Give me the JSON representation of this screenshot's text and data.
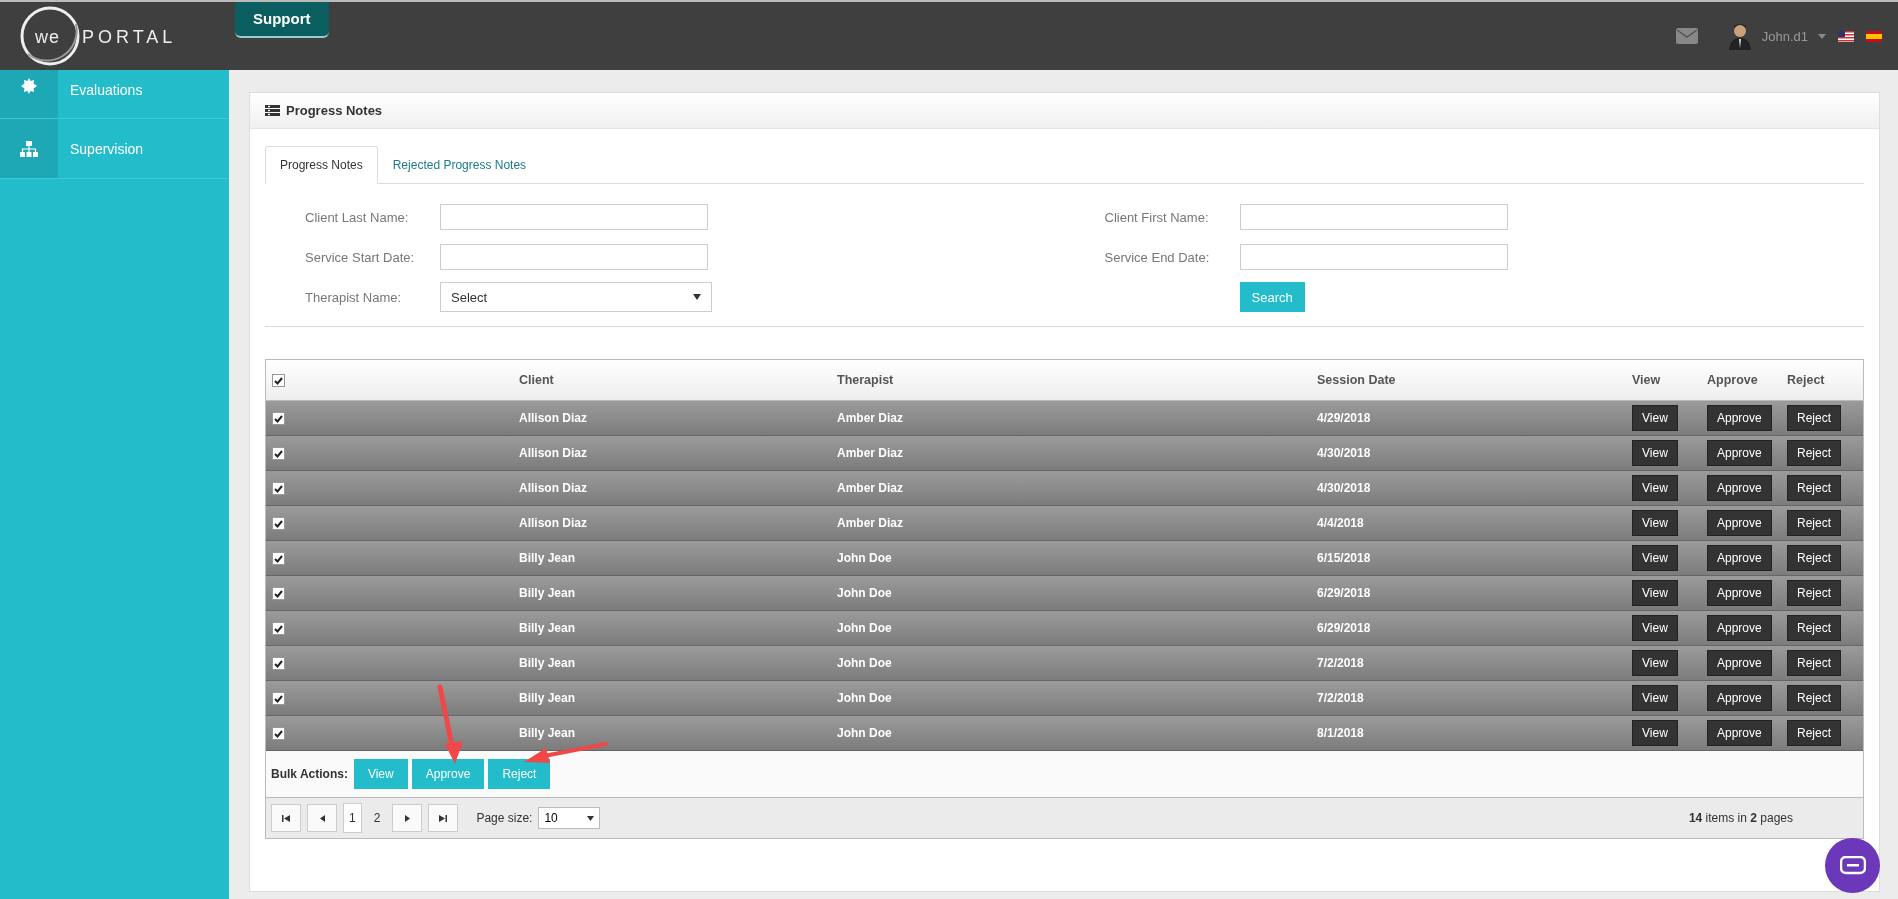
{
  "header": {
    "logo_prefix": "we",
    "logo_name": "PORTAL",
    "support_button": "Support",
    "user_name": "John.d1"
  },
  "sidebar": {
    "items": [
      {
        "label": "Evaluations"
      },
      {
        "label": "Supervision"
      }
    ]
  },
  "panel": {
    "title": "Progress Notes",
    "tabs": [
      {
        "label": "Progress Notes",
        "selected": true
      },
      {
        "label": "Rejected Progress Notes",
        "selected": false
      }
    ],
    "filters": [
      {
        "label": "Client Last Name:",
        "kind": "text"
      },
      {
        "label": "Client First Name:",
        "kind": "text"
      },
      {
        "label": "Service Start Date:",
        "kind": "text"
      },
      {
        "label": "Service End Date:",
        "kind": "text"
      },
      {
        "label": "Therapist Name:",
        "kind": "select",
        "value": "Select"
      },
      {
        "label": "Search",
        "kind": "button"
      }
    ],
    "table": {
      "header_checked": true,
      "columns": [
        "Client",
        "Therapist",
        "Session Date",
        "View",
        "Approve",
        "Reject"
      ],
      "rows": [
        {
          "checked": true,
          "client": "Allison Diaz",
          "therapist": "Amber Diaz",
          "session_date": "4/29/2018",
          "view": "View",
          "approve": "Approve",
          "reject": "Reject"
        },
        {
          "checked": true,
          "client": "Allison Diaz",
          "therapist": "Amber Diaz",
          "session_date": "4/30/2018",
          "view": "View",
          "approve": "Approve",
          "reject": "Reject"
        },
        {
          "checked": true,
          "client": "Allison Diaz",
          "therapist": "Amber Diaz",
          "session_date": "4/30/2018",
          "view": "View",
          "approve": "Approve",
          "reject": "Reject"
        },
        {
          "checked": true,
          "client": "Allison Diaz",
          "therapist": "Amber Diaz",
          "session_date": "4/4/2018",
          "view": "View",
          "approve": "Approve",
          "reject": "Reject"
        },
        {
          "checked": true,
          "client": "Billy Jean",
          "therapist": "John Doe",
          "session_date": "6/15/2018",
          "view": "View",
          "approve": "Approve",
          "reject": "Reject"
        },
        {
          "checked": true,
          "client": "Billy Jean",
          "therapist": "John Doe",
          "session_date": "6/29/2018",
          "view": "View",
          "approve": "Approve",
          "reject": "Reject"
        },
        {
          "checked": true,
          "client": "Billy Jean",
          "therapist": "John Doe",
          "session_date": "6/29/2018",
          "view": "View",
          "approve": "Approve",
          "reject": "Reject"
        },
        {
          "checked": true,
          "client": "Billy Jean",
          "therapist": "John Doe",
          "session_date": "7/2/2018",
          "view": "View",
          "approve": "Approve",
          "reject": "Reject"
        },
        {
          "checked": true,
          "client": "Billy Jean",
          "therapist": "John Doe",
          "session_date": "7/2/2018",
          "view": "View",
          "approve": "Approve",
          "reject": "Reject"
        },
        {
          "checked": true,
          "client": "Billy Jean",
          "therapist": "John Doe",
          "session_date": "8/1/2018",
          "view": "View",
          "approve": "Approve",
          "reject": "Reject"
        }
      ],
      "bulk_label": "Bulk Actions:",
      "bulk_buttons": [
        "View",
        "Approve",
        "Reject"
      ],
      "pages": [
        {
          "label": "1",
          "selected": true
        },
        {
          "label": "2",
          "selected": false
        }
      ],
      "page_size_label": "Page size:",
      "page_size": "10",
      "summary": "**14** items in **2** pages"
    }
  }
}
